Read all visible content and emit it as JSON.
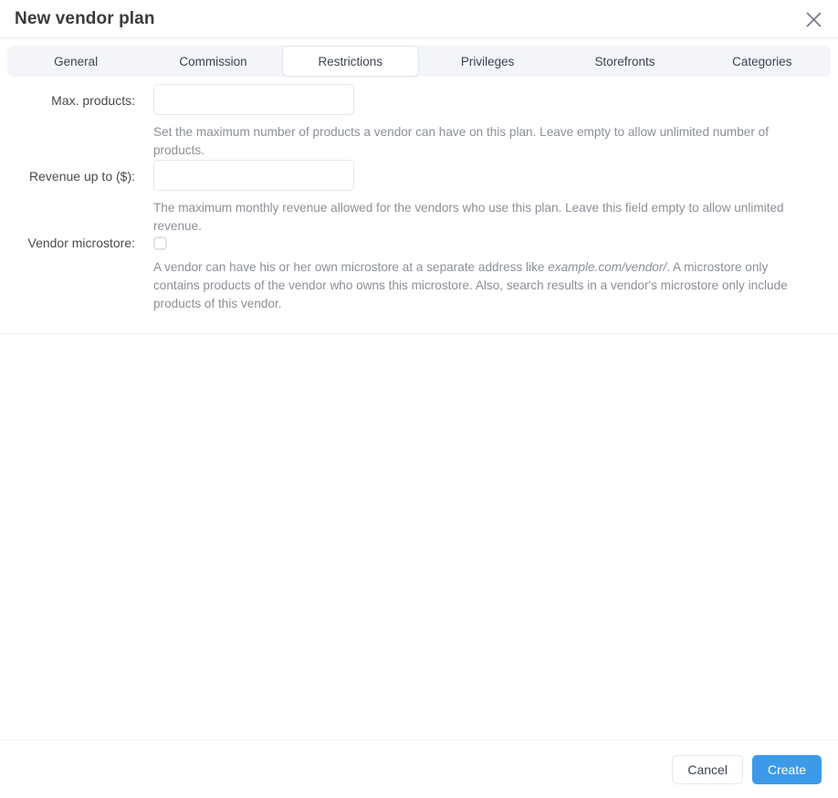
{
  "dialog": {
    "title": "New vendor plan",
    "close_icon": "close-icon"
  },
  "tabs": [
    {
      "label": "General",
      "active": false
    },
    {
      "label": "Commission",
      "active": false
    },
    {
      "label": "Restrictions",
      "active": true
    },
    {
      "label": "Privileges",
      "active": false
    },
    {
      "label": "Storefronts",
      "active": false
    },
    {
      "label": "Categories",
      "active": false
    }
  ],
  "form": {
    "max_products": {
      "label": "Max. products:",
      "value": "",
      "placeholder": "",
      "help": "Set the maximum number of products a vendor can have on this plan. Leave empty to allow unlimited number of products."
    },
    "revenue_up_to": {
      "label": "Revenue up to ($):",
      "value": "",
      "placeholder": "",
      "help": "The maximum monthly revenue allowed for the vendors who use this plan. Leave this field empty to allow unlimited revenue."
    },
    "vendor_microstore": {
      "label": "Vendor microstore:",
      "checked": false,
      "help_part1": "A vendor can have his or her own microstore at a separate address like ",
      "help_italic": "example.com/vendor/",
      "help_part2": ". A microstore only contains products of the vendor who owns this microstore. Also, search results in a vendor's microstore only include products of this vendor."
    }
  },
  "footer": {
    "cancel_label": "Cancel",
    "create_label": "Create"
  },
  "colors": {
    "accent": "#3d9ae8",
    "tabbar_bg": "#f3f5f9",
    "help_text": "#8b9099",
    "border": "#e2e8f2"
  }
}
